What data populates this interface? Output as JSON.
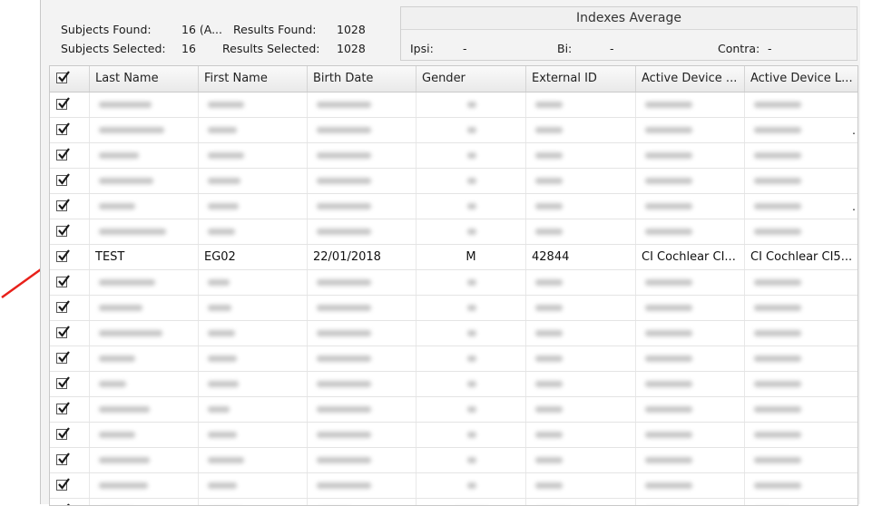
{
  "summary": {
    "subjects_found_label": "Subjects Found:",
    "subjects_found_value": "16 (A...",
    "results_found_label": "Results Found:",
    "results_found_value": "1028",
    "subjects_selected_label": "Subjects Selected:",
    "subjects_selected_value": "16",
    "results_selected_label": "Results Selected:",
    "results_selected_value": "1028"
  },
  "indexes": {
    "title": "Indexes Average",
    "ipsi_label": "Ipsi:",
    "ipsi_value": "-",
    "bi_label": "Bi:",
    "bi_value": "-",
    "contra_label": "Contra:",
    "contra_value": "-"
  },
  "columns": [
    {
      "key": "check",
      "label": ""
    },
    {
      "key": "last_name",
      "label": "Last Name"
    },
    {
      "key": "first_name",
      "label": "First Name"
    },
    {
      "key": "birth_date",
      "label": "Birth Date"
    },
    {
      "key": "gender",
      "label": "Gender"
    },
    {
      "key": "external_id",
      "label": "External ID"
    },
    {
      "key": "active_device_1",
      "label": "Active Device ..."
    },
    {
      "key": "active_device_2",
      "label": "Active Device L..."
    }
  ],
  "rows": [
    {
      "checked": true,
      "visible": false
    },
    {
      "checked": true,
      "visible": false,
      "trailing": "."
    },
    {
      "checked": true,
      "visible": false
    },
    {
      "checked": true,
      "visible": false
    },
    {
      "checked": true,
      "visible": false,
      "trailing": "."
    },
    {
      "checked": true,
      "visible": false
    },
    {
      "checked": true,
      "visible": true,
      "last_name": "TEST",
      "first_name": "EG02",
      "birth_date": "22/01/2018",
      "gender": "M",
      "external_id": "42844",
      "active_device_1": "CI Cochlear CI...",
      "active_device_2": "CI Cochlear CI5..."
    },
    {
      "checked": true,
      "visible": false
    },
    {
      "checked": true,
      "visible": false
    },
    {
      "checked": true,
      "visible": false
    },
    {
      "checked": true,
      "visible": false
    },
    {
      "checked": true,
      "visible": false
    },
    {
      "checked": true,
      "visible": false
    },
    {
      "checked": true,
      "visible": false
    },
    {
      "checked": true,
      "visible": false
    },
    {
      "checked": true,
      "visible": false
    },
    {
      "checked": true,
      "visible": false
    }
  ],
  "colors": {
    "arrow": "#e8201a",
    "check": "#1a1a1a"
  }
}
